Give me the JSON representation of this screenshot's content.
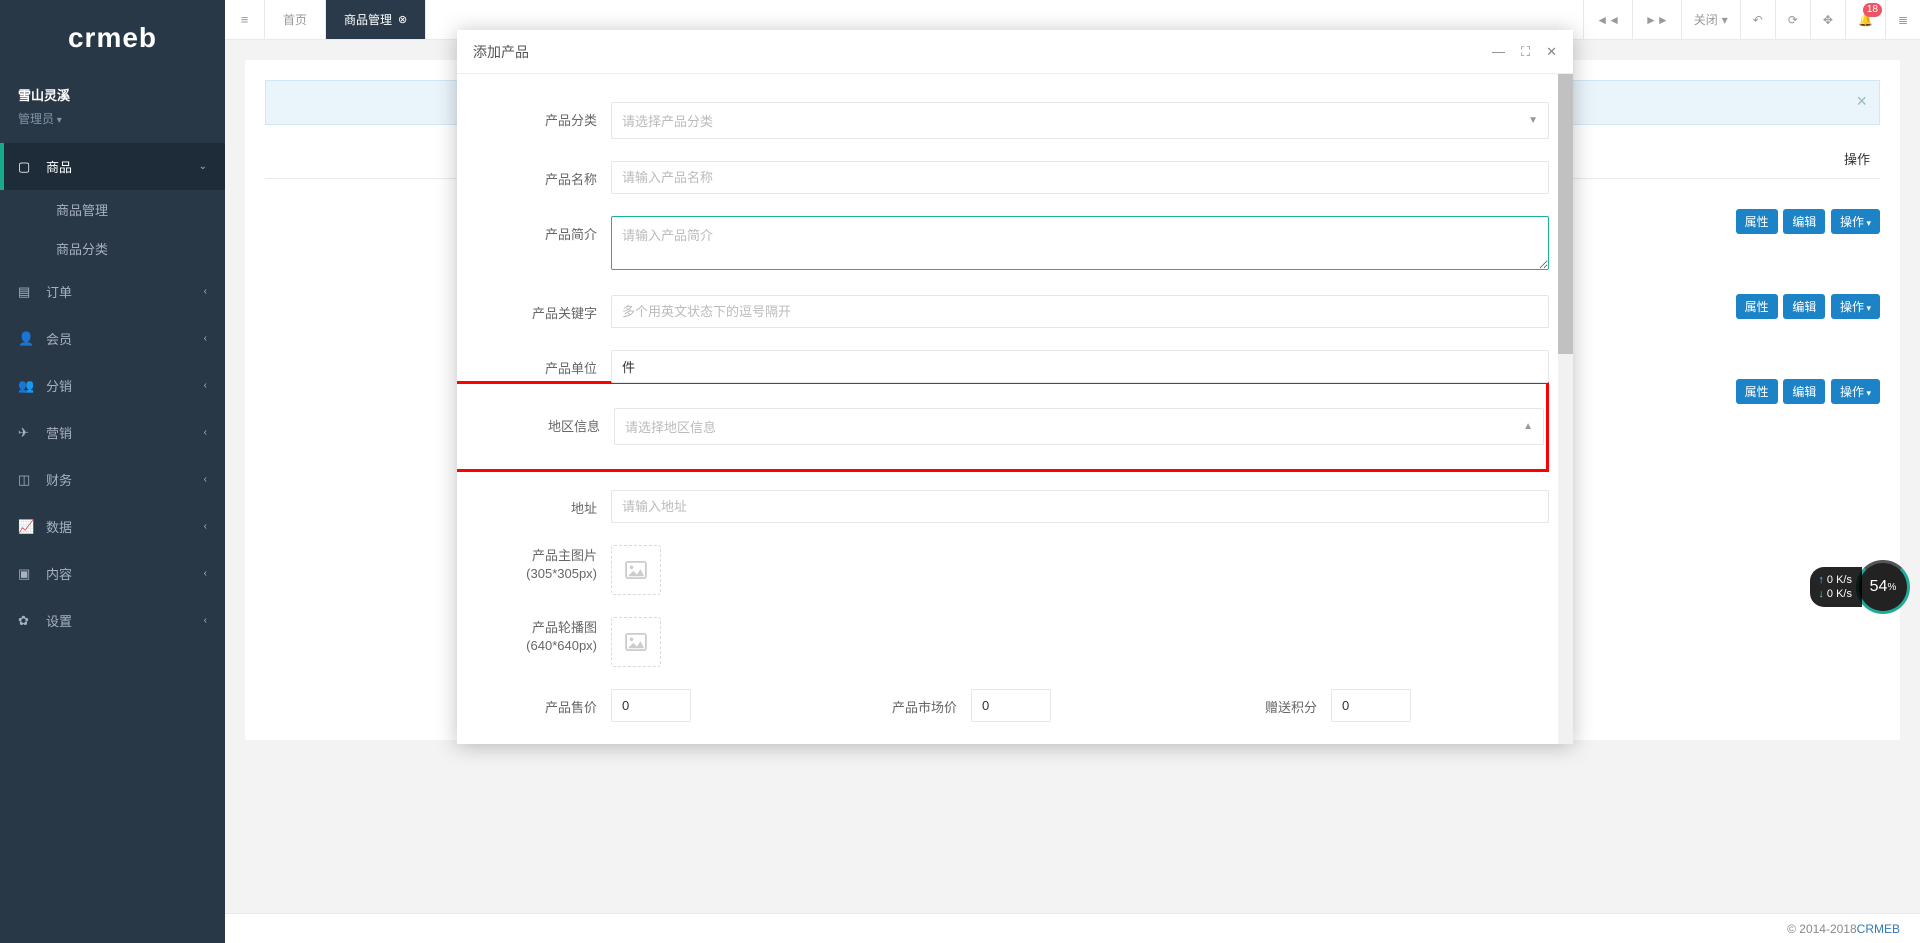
{
  "logo": "crmeb",
  "user": {
    "name": "雪山灵溪",
    "role": "管理员"
  },
  "nav": [
    {
      "icon": "laptop",
      "label": "商品",
      "active": true,
      "children": [
        {
          "label": "商品管理"
        },
        {
          "label": "商品分类"
        }
      ]
    },
    {
      "icon": "doc",
      "label": "订单"
    },
    {
      "icon": "user",
      "label": "会员"
    },
    {
      "icon": "group",
      "label": "分销"
    },
    {
      "icon": "send",
      "label": "营销"
    },
    {
      "icon": "money",
      "label": "财务"
    },
    {
      "icon": "chart",
      "label": "数据"
    },
    {
      "icon": "book",
      "label": "内容"
    },
    {
      "icon": "gear",
      "label": "设置"
    }
  ],
  "tabs": {
    "home": "首页",
    "active": "商品管理"
  },
  "topbar": {
    "close_label": "关闭",
    "badge": "18"
  },
  "modal": {
    "title": "添加产品",
    "fields": {
      "category_label": "产品分类",
      "category_placeholder": "请选择产品分类",
      "name_label": "产品名称",
      "name_placeholder": "请输入产品名称",
      "intro_label": "产品简介",
      "intro_placeholder": "请输入产品简介",
      "keyword_label": "产品关键字",
      "keyword_placeholder": "多个用英文状态下的逗号隔开",
      "unit_label": "产品单位",
      "unit_value": "件",
      "region_label": "地区信息",
      "region_placeholder": "请选择地区信息",
      "address_label": "地址",
      "address_placeholder": "请输入地址",
      "main_img_label_l1": "产品主图片",
      "main_img_label_l2": "(305*305px)",
      "carousel_label_l1": "产品轮播图",
      "carousel_label_l2": "(640*640px)",
      "price_label": "产品售价",
      "price_value": "0",
      "market_label": "产品市场价",
      "market_value": "0",
      "points_label": "赠送积分",
      "points_value": "0"
    }
  },
  "bg": {
    "col_action": "操作",
    "btn_attr": "属性",
    "btn_edit": "编辑",
    "btn_op": "操作"
  },
  "footer": {
    "text": "© 2014-2018 ",
    "link": "CRMEB"
  },
  "perf": {
    "up": "0 K/s",
    "dn": "0 K/s",
    "pct": "54"
  }
}
